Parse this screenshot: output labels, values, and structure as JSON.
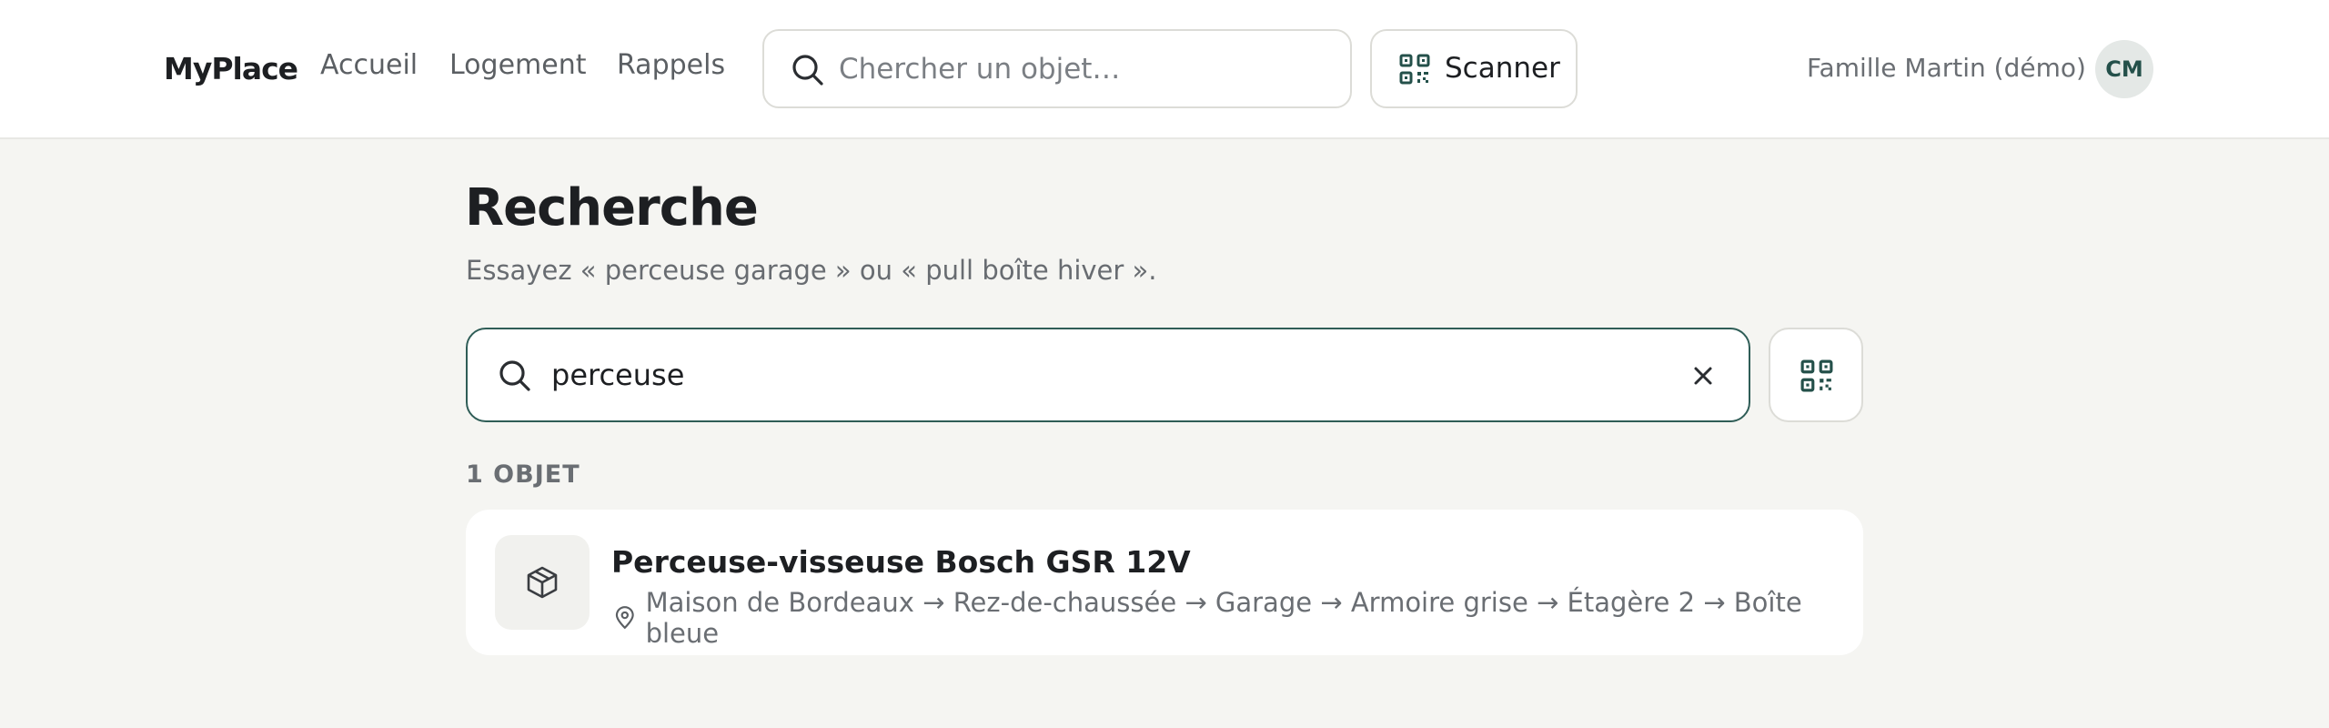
{
  "app": {
    "brand": "MyPlace"
  },
  "nav": {
    "items": [
      "Accueil",
      "Logement",
      "Rappels"
    ]
  },
  "header": {
    "search_placeholder": "Chercher un objet…",
    "scan_label": "Scanner",
    "user_name": "Famille Martin (démo)",
    "avatar_initials": "CM"
  },
  "main": {
    "title": "Recherche",
    "subtitle": "Essayez « perceuse garage » ou « pull boîte hiver ».",
    "search_value": "perceuse",
    "result_count": "1 OBJET",
    "results": [
      {
        "name": "Perceuse-visseuse Bosch GSR 12V",
        "path": "Maison de Bordeaux → Rez-de-chaussée → Garage → Armoire grise → Étagère 2 → Boîte bleue"
      }
    ]
  },
  "colors": {
    "accent": "#2f5d57",
    "background": "#f5f5f2",
    "card": "#ffffff",
    "avatar_bg": "#e4e8e6"
  },
  "icons": [
    "search-icon",
    "qr-code-icon",
    "close-icon",
    "box-icon",
    "location-pin-icon"
  ]
}
